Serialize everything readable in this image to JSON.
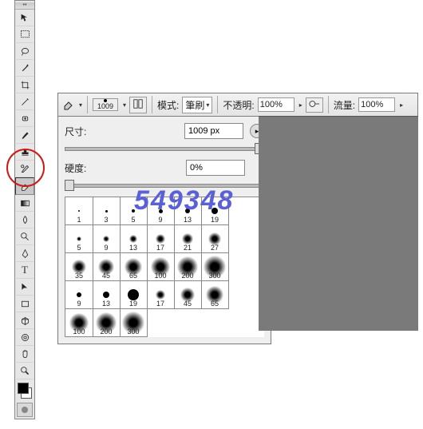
{
  "options_bar": {
    "brush_size": "1009",
    "mode_label": "模式:",
    "mode_value": "筆刷",
    "opacity_label": "不透明:",
    "opacity_value": "100%",
    "flow_label": "流量:",
    "flow_value": "100%"
  },
  "brush_panel": {
    "size_label": "尺寸:",
    "size_value": "1009 px",
    "hardness_label": "硬度:",
    "hardness_value": "0%",
    "presets": [
      {
        "size": "1",
        "d": 2,
        "soft": false
      },
      {
        "size": "3",
        "d": 3,
        "soft": false
      },
      {
        "size": "5",
        "d": 4,
        "soft": false
      },
      {
        "size": "9",
        "d": 5,
        "soft": false
      },
      {
        "size": "13",
        "d": 6,
        "soft": false
      },
      {
        "size": "19",
        "d": 8,
        "soft": false
      },
      {
        "size": "5",
        "d": 6,
        "soft": true
      },
      {
        "size": "9",
        "d": 8,
        "soft": true
      },
      {
        "size": "13",
        "d": 10,
        "soft": true
      },
      {
        "size": "17",
        "d": 12,
        "soft": true
      },
      {
        "size": "21",
        "d": 14,
        "soft": true
      },
      {
        "size": "27",
        "d": 16,
        "soft": true
      },
      {
        "size": "35",
        "d": 18,
        "soft": true
      },
      {
        "size": "45",
        "d": 20,
        "soft": true
      },
      {
        "size": "65",
        "d": 22,
        "soft": true
      },
      {
        "size": "100",
        "d": 24,
        "soft": true
      },
      {
        "size": "200",
        "d": 26,
        "soft": true
      },
      {
        "size": "300",
        "d": 28,
        "soft": true
      },
      {
        "size": "9",
        "d": 6,
        "soft": false
      },
      {
        "size": "13",
        "d": 8,
        "soft": false
      },
      {
        "size": "19",
        "d": 14,
        "soft": false
      },
      {
        "size": "17",
        "d": 12,
        "soft": true
      },
      {
        "size": "45",
        "d": 18,
        "soft": true
      },
      {
        "size": "65",
        "d": 22,
        "soft": true
      },
      {
        "size": "100",
        "d": 24,
        "soft": true
      },
      {
        "size": "200",
        "d": 26,
        "soft": true
      },
      {
        "size": "300",
        "d": 28,
        "soft": true
      }
    ]
  },
  "watermark": "549348"
}
